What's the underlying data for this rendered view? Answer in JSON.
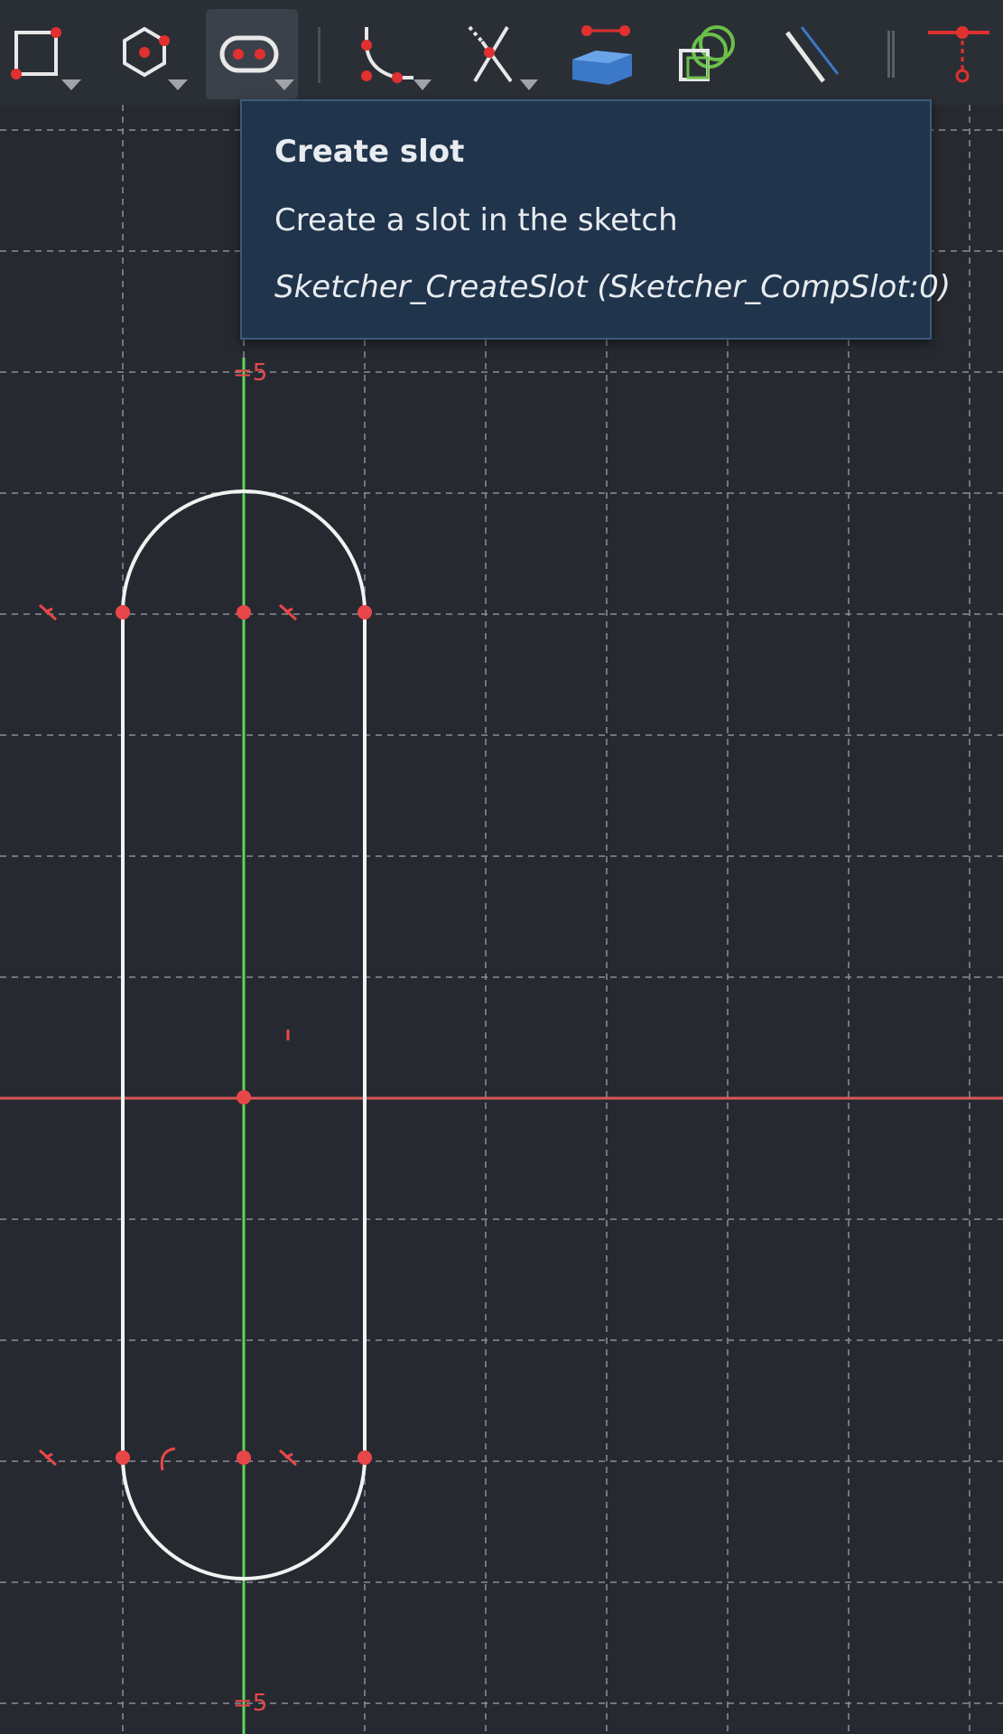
{
  "toolbar": {
    "buttons": [
      {
        "name": "rectangle-tool",
        "icon": "rectangle-icon"
      },
      {
        "name": "polygon-tool",
        "icon": "hexagon-icon"
      },
      {
        "name": "slot-tool",
        "icon": "slot-icon",
        "active": true
      },
      {
        "name": "fillet-tool",
        "icon": "fillet-icon"
      },
      {
        "name": "trim-tool",
        "icon": "trim-icon"
      },
      {
        "name": "external-geometry-tool",
        "icon": "external-geometry-icon"
      },
      {
        "name": "carbon-copy-tool",
        "icon": "carbon-copy-icon"
      },
      {
        "name": "construction-toggle-tool",
        "icon": "construction-line-icon"
      },
      {
        "name": "constrain-point-tool",
        "icon": "constrain-point-icon"
      }
    ]
  },
  "tooltip": {
    "title": "Create slot",
    "description": "Create a slot in the sketch",
    "command": "Sketcher_CreateSlot (Sketcher_CompSlot:0)"
  },
  "sketch": {
    "dimension_top": "5",
    "dimension_bottom": "5",
    "colors": {
      "background": "#262a30",
      "geometry": "#f2f2f2",
      "vertex": "#e8474a",
      "vertical_axis": "#5fd35f",
      "horizontal_axis": "#d95757",
      "tooltip_bg": "#20344c"
    }
  }
}
